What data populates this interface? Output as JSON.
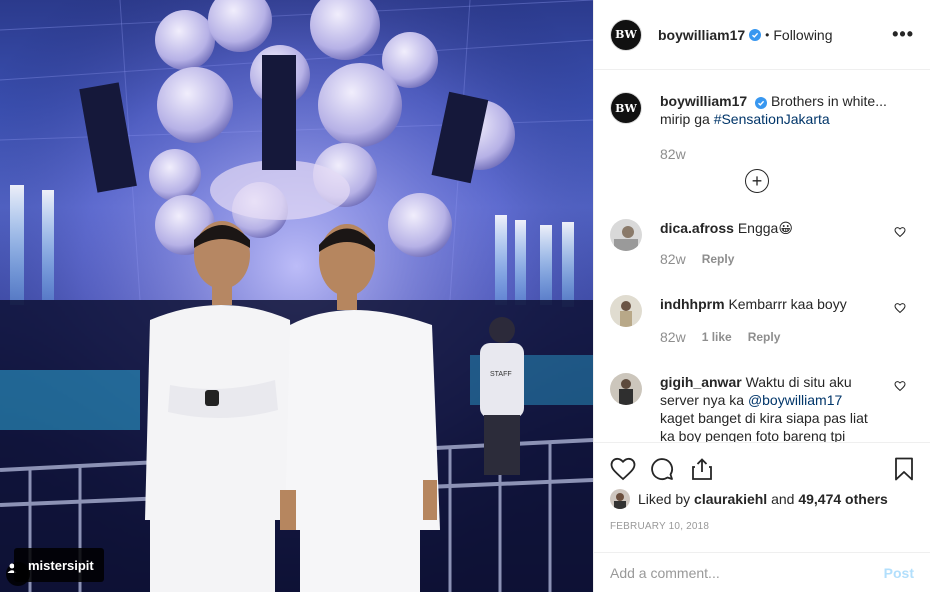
{
  "photo": {
    "tag_username": "mistersipit",
    "user_tag_icon": "person-icon",
    "staff_text": "STAFF"
  },
  "header": {
    "avatar_text": "BW",
    "username": "boywilliam17",
    "separator": "•",
    "follow_status": "Following",
    "more_label": "•••",
    "verified_icon": "verified-check-icon"
  },
  "caption": {
    "username": "boywilliam17",
    "text": "Brothers in white...",
    "line2_prefix": "mirip ga ",
    "hashtag": "#SensationJakarta",
    "age": "82w"
  },
  "load_more_icon": "plus-circle-icon",
  "comments": [
    {
      "username": "dica.afross",
      "text": "Engga",
      "emoji": "😀",
      "age": "82w",
      "likes": "",
      "reply": "Reply"
    },
    {
      "username": "indhhprm",
      "text": "Kembarrr kaa boyy",
      "age": "82w",
      "likes": "1 like",
      "reply": "Reply"
    },
    {
      "username": "gigih_anwar",
      "text_a": "Waktu di situ aku server nya ka ",
      "mention": "@boywilliam17",
      "text_b": " kaget banget di kira siapa pas liat ka boy pengen foto bareng tpi"
    }
  ],
  "actions": {
    "icons": [
      "heart-icon",
      "comment-icon",
      "share-icon",
      "bookmark-icon"
    ],
    "liked_prefix": "Liked by ",
    "liked_user": "claurakiehl",
    "liked_mid": " and ",
    "liked_count": "49,474 others",
    "date": "FEBRUARY 10, 2018"
  },
  "add_comment": {
    "placeholder": "Add a comment...",
    "post_label": "Post"
  },
  "colors": {
    "accent_link": "#003569",
    "verified": "#3897f0",
    "post_disabled": "#b2dffc",
    "muted": "#8e8e8e"
  }
}
